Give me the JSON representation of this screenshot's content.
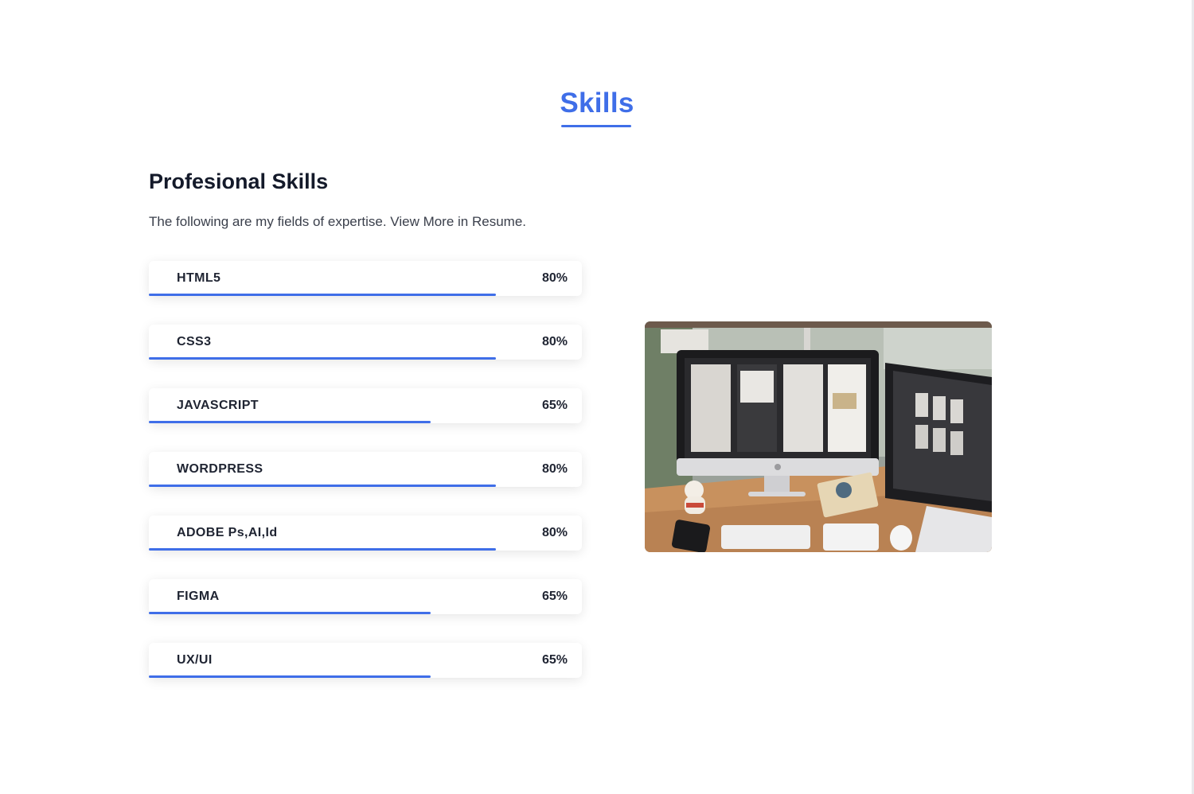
{
  "section": {
    "title": "Skills"
  },
  "skills_block": {
    "heading": "Profesional Skills",
    "description": "The following are my fields of expertise. View More in Resume."
  },
  "skills": [
    {
      "name": "HTML5",
      "percent_label": "80%",
      "level": 0.8
    },
    {
      "name": "CSS3",
      "percent_label": "80%",
      "level": 0.8
    },
    {
      "name": "JAVASCRIPT",
      "percent_label": "65%",
      "level": 0.65
    },
    {
      "name": "WORDPRESS",
      "percent_label": "80%",
      "level": 0.8
    },
    {
      "name": "ADOBE Ps,AI,Id",
      "percent_label": "80%",
      "level": 0.8
    },
    {
      "name": "FIGMA",
      "percent_label": "65%",
      "level": 0.65
    },
    {
      "name": "UX/UI",
      "percent_label": "65%",
      "level": 0.65
    }
  ],
  "colors": {
    "accent": "#3f6ee8",
    "heading_text": "#141a2a",
    "body_text": "#3a3f4b"
  }
}
